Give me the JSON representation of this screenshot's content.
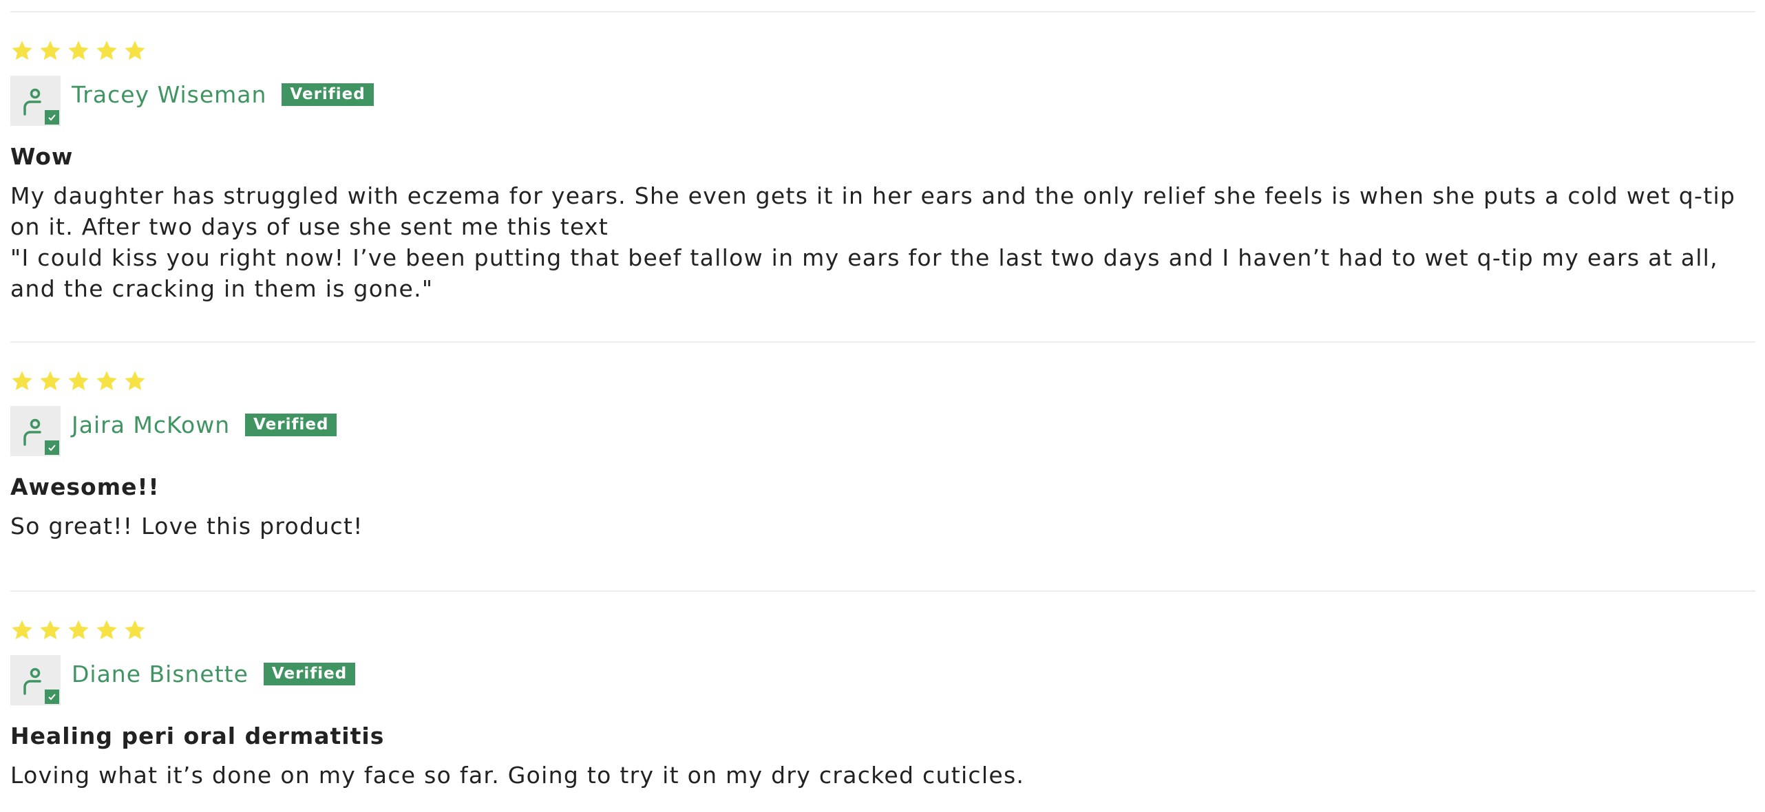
{
  "colors": {
    "accent": "#3f9461",
    "star": "#f7e245",
    "avatar_bg": "#ececec",
    "divider": "#ececec",
    "text": "#222222"
  },
  "reviews": [
    {
      "rating": 5,
      "rating_max": 5,
      "author": "Tracey Wiseman",
      "badge": "Verified",
      "title": "Wow",
      "body": "My daughter has struggled with eczema for years. She even gets it in her ears and the only relief she feels is when she puts a cold wet q-tip on it. After two days of use she sent me this text\n\"I could kiss you right now! I’ve been putting that beef tallow in my ears for the last two days and I haven’t had to wet q-tip my ears at all, and the cracking in them is gone.\""
    },
    {
      "rating": 5,
      "rating_max": 5,
      "author": "Jaira McKown",
      "badge": "Verified",
      "title": "Awesome!!",
      "body": "So great!! Love this product!"
    },
    {
      "rating": 5,
      "rating_max": 5,
      "author": "Diane Bisnette",
      "badge": "Verified",
      "title": "Healing peri oral dermatitis",
      "body": "Loving what it’s done on my face so far. Going to try it on my dry cracked cuticles."
    }
  ]
}
